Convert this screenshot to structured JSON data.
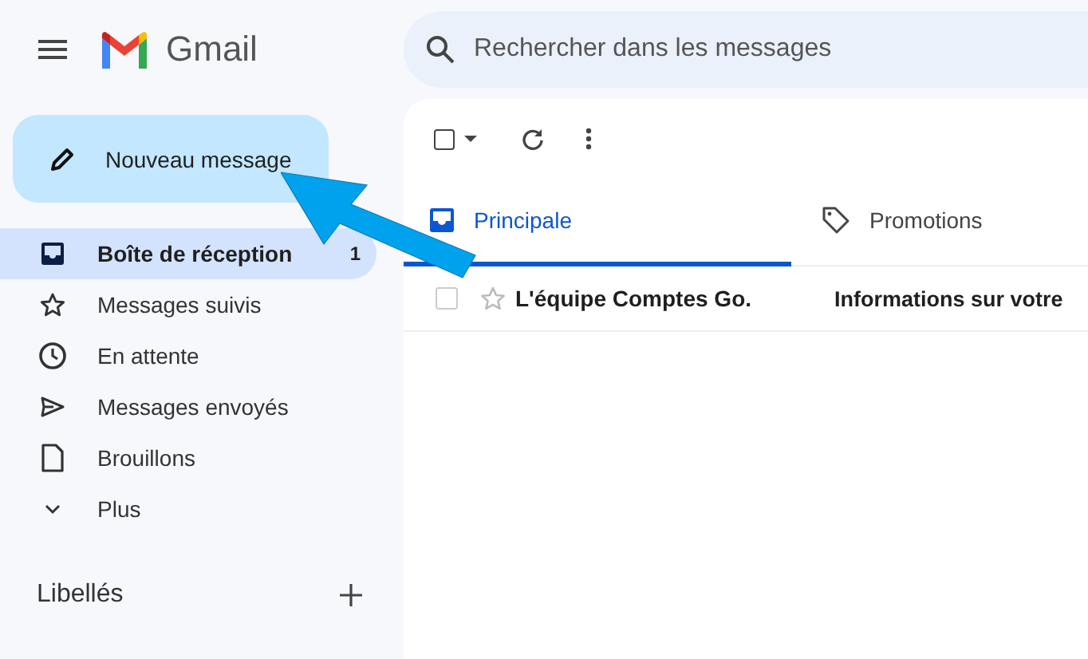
{
  "header": {
    "app_name": "Gmail",
    "search": {
      "placeholder": "Rechercher dans les messages"
    }
  },
  "compose_button": {
    "label": "Nouveau message"
  },
  "nav": [
    {
      "kind": "inbox",
      "label": "Boîte de réception",
      "count": "1",
      "selected": true
    },
    {
      "kind": "star",
      "label": "Messages suivis",
      "selected": false
    },
    {
      "kind": "clock",
      "label": "En attente",
      "selected": false
    },
    {
      "kind": "send",
      "label": "Messages envoyés",
      "selected": false
    },
    {
      "kind": "file",
      "label": "Brouillons",
      "selected": false
    },
    {
      "kind": "more",
      "label": "Plus",
      "selected": false
    }
  ],
  "labels": {
    "title": "Libellés"
  },
  "toolbar": {
    "select_all_checked": false
  },
  "tabs": [
    {
      "kind": "inbox",
      "label": "Principale",
      "selected": true
    },
    {
      "kind": "tag",
      "label": "Promotions",
      "selected": false
    }
  ],
  "messages": [
    {
      "sender": "L'équipe Comptes Go.",
      "subject": "Informations sur votre",
      "checked": false,
      "starred": false,
      "unread": true
    }
  ],
  "annotation": {
    "kind": "arrow"
  }
}
